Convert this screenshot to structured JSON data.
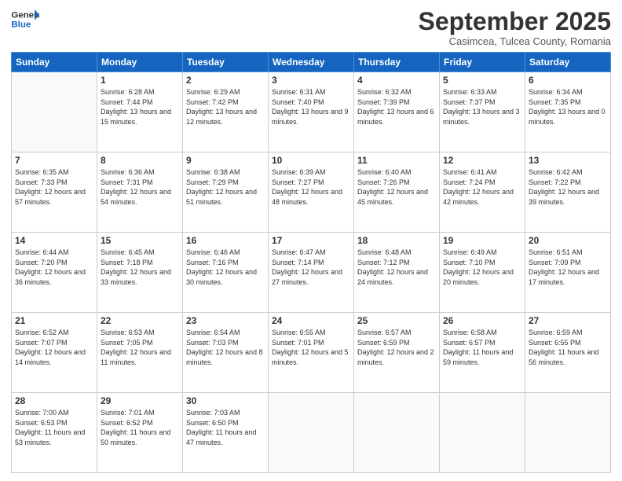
{
  "header": {
    "logo_general": "General",
    "logo_blue": "Blue",
    "month_title": "September 2025",
    "subtitle": "Casimcea, Tulcea County, Romania"
  },
  "days_of_week": [
    "Sunday",
    "Monday",
    "Tuesday",
    "Wednesday",
    "Thursday",
    "Friday",
    "Saturday"
  ],
  "weeks": [
    [
      {
        "day": "",
        "sunrise": "",
        "sunset": "",
        "daylight": ""
      },
      {
        "day": "1",
        "sunrise": "Sunrise: 6:28 AM",
        "sunset": "Sunset: 7:44 PM",
        "daylight": "Daylight: 13 hours and 15 minutes."
      },
      {
        "day": "2",
        "sunrise": "Sunrise: 6:29 AM",
        "sunset": "Sunset: 7:42 PM",
        "daylight": "Daylight: 13 hours and 12 minutes."
      },
      {
        "day": "3",
        "sunrise": "Sunrise: 6:31 AM",
        "sunset": "Sunset: 7:40 PM",
        "daylight": "Daylight: 13 hours and 9 minutes."
      },
      {
        "day": "4",
        "sunrise": "Sunrise: 6:32 AM",
        "sunset": "Sunset: 7:39 PM",
        "daylight": "Daylight: 13 hours and 6 minutes."
      },
      {
        "day": "5",
        "sunrise": "Sunrise: 6:33 AM",
        "sunset": "Sunset: 7:37 PM",
        "daylight": "Daylight: 13 hours and 3 minutes."
      },
      {
        "day": "6",
        "sunrise": "Sunrise: 6:34 AM",
        "sunset": "Sunset: 7:35 PM",
        "daylight": "Daylight: 13 hours and 0 minutes."
      }
    ],
    [
      {
        "day": "7",
        "sunrise": "Sunrise: 6:35 AM",
        "sunset": "Sunset: 7:33 PM",
        "daylight": "Daylight: 12 hours and 57 minutes."
      },
      {
        "day": "8",
        "sunrise": "Sunrise: 6:36 AM",
        "sunset": "Sunset: 7:31 PM",
        "daylight": "Daylight: 12 hours and 54 minutes."
      },
      {
        "day": "9",
        "sunrise": "Sunrise: 6:38 AM",
        "sunset": "Sunset: 7:29 PM",
        "daylight": "Daylight: 12 hours and 51 minutes."
      },
      {
        "day": "10",
        "sunrise": "Sunrise: 6:39 AM",
        "sunset": "Sunset: 7:27 PM",
        "daylight": "Daylight: 12 hours and 48 minutes."
      },
      {
        "day": "11",
        "sunrise": "Sunrise: 6:40 AM",
        "sunset": "Sunset: 7:26 PM",
        "daylight": "Daylight: 12 hours and 45 minutes."
      },
      {
        "day": "12",
        "sunrise": "Sunrise: 6:41 AM",
        "sunset": "Sunset: 7:24 PM",
        "daylight": "Daylight: 12 hours and 42 minutes."
      },
      {
        "day": "13",
        "sunrise": "Sunrise: 6:42 AM",
        "sunset": "Sunset: 7:22 PM",
        "daylight": "Daylight: 12 hours and 39 minutes."
      }
    ],
    [
      {
        "day": "14",
        "sunrise": "Sunrise: 6:44 AM",
        "sunset": "Sunset: 7:20 PM",
        "daylight": "Daylight: 12 hours and 36 minutes."
      },
      {
        "day": "15",
        "sunrise": "Sunrise: 6:45 AM",
        "sunset": "Sunset: 7:18 PM",
        "daylight": "Daylight: 12 hours and 33 minutes."
      },
      {
        "day": "16",
        "sunrise": "Sunrise: 6:46 AM",
        "sunset": "Sunset: 7:16 PM",
        "daylight": "Daylight: 12 hours and 30 minutes."
      },
      {
        "day": "17",
        "sunrise": "Sunrise: 6:47 AM",
        "sunset": "Sunset: 7:14 PM",
        "daylight": "Daylight: 12 hours and 27 minutes."
      },
      {
        "day": "18",
        "sunrise": "Sunrise: 6:48 AM",
        "sunset": "Sunset: 7:12 PM",
        "daylight": "Daylight: 12 hours and 24 minutes."
      },
      {
        "day": "19",
        "sunrise": "Sunrise: 6:49 AM",
        "sunset": "Sunset: 7:10 PM",
        "daylight": "Daylight: 12 hours and 20 minutes."
      },
      {
        "day": "20",
        "sunrise": "Sunrise: 6:51 AM",
        "sunset": "Sunset: 7:09 PM",
        "daylight": "Daylight: 12 hours and 17 minutes."
      }
    ],
    [
      {
        "day": "21",
        "sunrise": "Sunrise: 6:52 AM",
        "sunset": "Sunset: 7:07 PM",
        "daylight": "Daylight: 12 hours and 14 minutes."
      },
      {
        "day": "22",
        "sunrise": "Sunrise: 6:53 AM",
        "sunset": "Sunset: 7:05 PM",
        "daylight": "Daylight: 12 hours and 11 minutes."
      },
      {
        "day": "23",
        "sunrise": "Sunrise: 6:54 AM",
        "sunset": "Sunset: 7:03 PM",
        "daylight": "Daylight: 12 hours and 8 minutes."
      },
      {
        "day": "24",
        "sunrise": "Sunrise: 6:55 AM",
        "sunset": "Sunset: 7:01 PM",
        "daylight": "Daylight: 12 hours and 5 minutes."
      },
      {
        "day": "25",
        "sunrise": "Sunrise: 6:57 AM",
        "sunset": "Sunset: 6:59 PM",
        "daylight": "Daylight: 12 hours and 2 minutes."
      },
      {
        "day": "26",
        "sunrise": "Sunrise: 6:58 AM",
        "sunset": "Sunset: 6:57 PM",
        "daylight": "Daylight: 11 hours and 59 minutes."
      },
      {
        "day": "27",
        "sunrise": "Sunrise: 6:59 AM",
        "sunset": "Sunset: 6:55 PM",
        "daylight": "Daylight: 11 hours and 56 minutes."
      }
    ],
    [
      {
        "day": "28",
        "sunrise": "Sunrise: 7:00 AM",
        "sunset": "Sunset: 6:53 PM",
        "daylight": "Daylight: 11 hours and 53 minutes."
      },
      {
        "day": "29",
        "sunrise": "Sunrise: 7:01 AM",
        "sunset": "Sunset: 6:52 PM",
        "daylight": "Daylight: 11 hours and 50 minutes."
      },
      {
        "day": "30",
        "sunrise": "Sunrise: 7:03 AM",
        "sunset": "Sunset: 6:50 PM",
        "daylight": "Daylight: 11 hours and 47 minutes."
      },
      {
        "day": "",
        "sunrise": "",
        "sunset": "",
        "daylight": ""
      },
      {
        "day": "",
        "sunrise": "",
        "sunset": "",
        "daylight": ""
      },
      {
        "day": "",
        "sunrise": "",
        "sunset": "",
        "daylight": ""
      },
      {
        "day": "",
        "sunrise": "",
        "sunset": "",
        "daylight": ""
      }
    ]
  ]
}
